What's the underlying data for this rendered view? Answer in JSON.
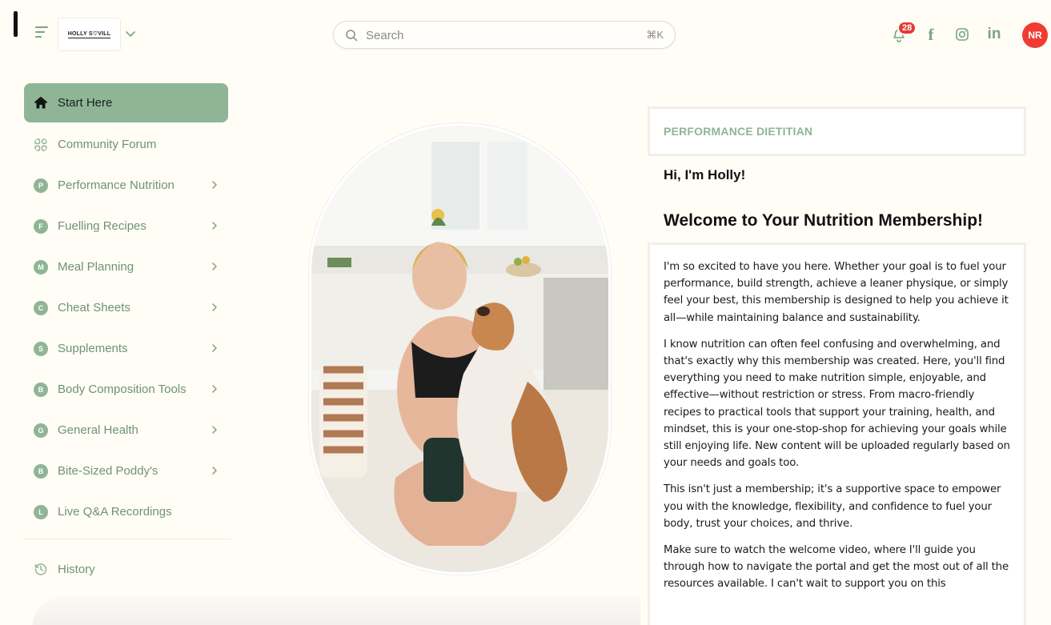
{
  "header": {
    "logo_text": "HOLLY S♡VILL",
    "search_placeholder": "Search",
    "search_shortcut": "⌘K",
    "notification_count": "28",
    "avatar_initials": "NR"
  },
  "icons": {
    "menu": "hamburger-icon",
    "dropdown": "chevron-down-icon",
    "search": "search-icon",
    "bell": "bell-icon",
    "facebook": "facebook-icon",
    "instagram": "instagram-icon",
    "linkedin": "linkedin-icon",
    "home": "home-icon",
    "community": "grid-icon",
    "history": "history-icon"
  },
  "colors": {
    "accent": "#8fb596",
    "accent_text": "#6f9277",
    "badge": "#e53935",
    "avatar": "#ef3b32",
    "background": "#fffdf6"
  },
  "sidebar": {
    "items": [
      {
        "label": "Start Here",
        "icon": "home-icon",
        "active": true
      },
      {
        "label": "Community Forum",
        "icon": "grid-icon"
      },
      {
        "label": "Performance Nutrition",
        "letter": "P",
        "has_children": true
      },
      {
        "label": "Fuelling Recipes",
        "letter": "F",
        "has_children": true
      },
      {
        "label": "Meal Planning",
        "letter": "M",
        "has_children": true
      },
      {
        "label": "Cheat Sheets",
        "letter": "C",
        "has_children": true
      },
      {
        "label": "Supplements",
        "letter": "S",
        "has_children": true
      },
      {
        "label": "Body Composition Tools",
        "letter": "B",
        "has_children": true
      },
      {
        "label": "General Health",
        "letter": "G",
        "has_children": true
      },
      {
        "label": "Bite-Sized Poddy's",
        "letter": "B",
        "has_children": true
      },
      {
        "label": "Live Q&A Recordings",
        "letter": "L"
      }
    ],
    "history_label": "History"
  },
  "content": {
    "role": "PERFORMANCE DIETITIAN",
    "greeting": "Hi, I'm Holly!",
    "title": "Welcome to Your Nutrition Membership!",
    "paragraphs": [
      "I'm so excited to have you here. Whether your goal is to fuel your performance, build strength, achieve a leaner physique, or simply feel your best, this membership is designed to help you achieve it all—while maintaining balance and sustainability.",
      "I know nutrition can often feel confusing and overwhelming, and that's exactly why this membership was created. Here, you'll find everything you need to make nutrition simple, enjoyable, and effective—without restriction or stress. From macro-friendly recipes to practical tools that support your training, health, and mindset, this is your one-stop-shop for achieving your goals while still enjoying life. New content will be uploaded regularly based on your needs and goals too.",
      "This isn't just a membership; it's a supportive space to empower you with the knowledge, flexibility, and confidence to fuel your body, trust your choices, and thrive.",
      "Make sure to watch the welcome video, where I'll guide you through how to navigate the portal and get the most out of all the resources available. I can't wait to support you on this"
    ]
  }
}
